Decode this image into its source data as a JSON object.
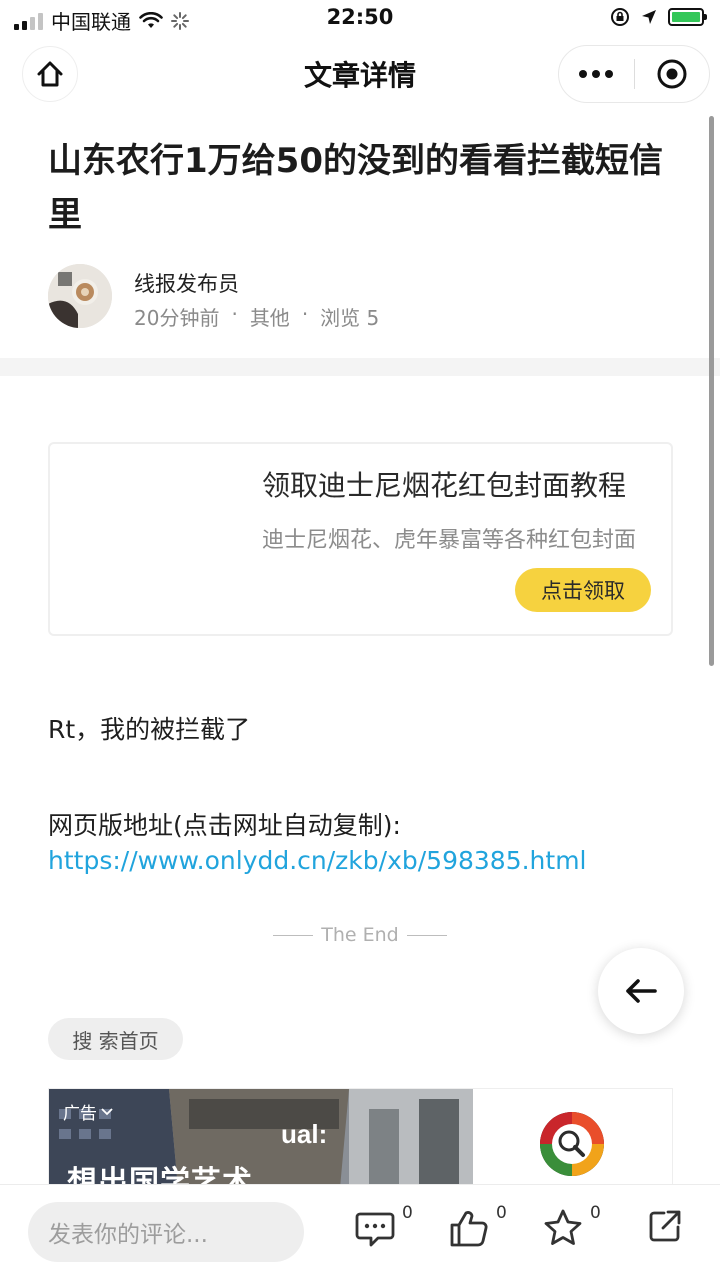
{
  "status_bar": {
    "carrier": "中国联通",
    "time": "22:50",
    "battery_color": "#34c759"
  },
  "nav": {
    "title": "文章详情",
    "home_icon": "home-icon",
    "more_icon": "more-dots-icon",
    "close_icon": "target-icon"
  },
  "article": {
    "title": "山东农行1万给50的没到的看看拦截短信里",
    "author": "线报发布员",
    "time_ago": "20分钟前",
    "dot1": "·",
    "category": "其他",
    "dot2": "·",
    "views": "浏览 5"
  },
  "promo": {
    "title": "领取迪士尼烟花红包封面教程",
    "description": "迪士尼烟花、虎年暴富等各种红包封面",
    "button": "点击领取",
    "accent": "#f6d23f"
  },
  "content": {
    "paragraph1": "Rt，我的被拦截了",
    "paragraph2": "网页版地址(点击网址自动复制):",
    "url": "https://www.onlydd.cn/zkb/xb/598385.html",
    "end_marker": "The End",
    "link_color": "#21a4dd"
  },
  "search_home": "搜 索首页",
  "ad": {
    "tag": "广告",
    "headline": "想出国学艺术"
  },
  "bottom_bar": {
    "comment_placeholder": "发表你的评论...",
    "comment_count": "0",
    "like_count": "0",
    "favorite_count": "0"
  }
}
